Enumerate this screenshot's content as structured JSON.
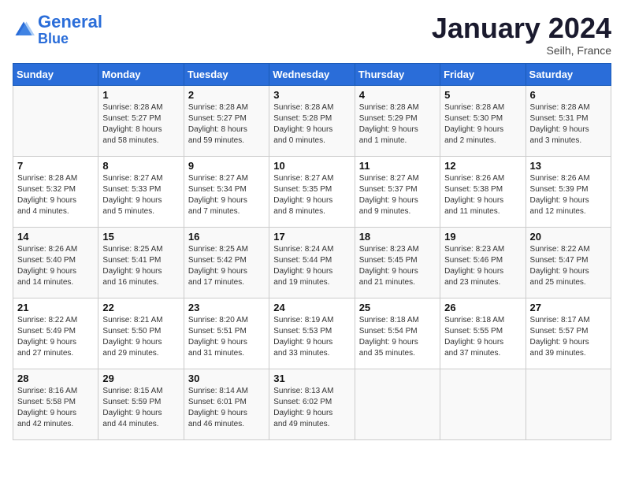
{
  "header": {
    "logo_line1": "General",
    "logo_line2": "Blue",
    "month_title": "January 2024",
    "location": "Seilh, France"
  },
  "days_of_week": [
    "Sunday",
    "Monday",
    "Tuesday",
    "Wednesday",
    "Thursday",
    "Friday",
    "Saturday"
  ],
  "weeks": [
    [
      {
        "day": "",
        "info": ""
      },
      {
        "day": "1",
        "info": "Sunrise: 8:28 AM\nSunset: 5:27 PM\nDaylight: 8 hours\nand 58 minutes."
      },
      {
        "day": "2",
        "info": "Sunrise: 8:28 AM\nSunset: 5:27 PM\nDaylight: 8 hours\nand 59 minutes."
      },
      {
        "day": "3",
        "info": "Sunrise: 8:28 AM\nSunset: 5:28 PM\nDaylight: 9 hours\nand 0 minutes."
      },
      {
        "day": "4",
        "info": "Sunrise: 8:28 AM\nSunset: 5:29 PM\nDaylight: 9 hours\nand 1 minute."
      },
      {
        "day": "5",
        "info": "Sunrise: 8:28 AM\nSunset: 5:30 PM\nDaylight: 9 hours\nand 2 minutes."
      },
      {
        "day": "6",
        "info": "Sunrise: 8:28 AM\nSunset: 5:31 PM\nDaylight: 9 hours\nand 3 minutes."
      }
    ],
    [
      {
        "day": "7",
        "info": "Sunrise: 8:28 AM\nSunset: 5:32 PM\nDaylight: 9 hours\nand 4 minutes."
      },
      {
        "day": "8",
        "info": "Sunrise: 8:27 AM\nSunset: 5:33 PM\nDaylight: 9 hours\nand 5 minutes."
      },
      {
        "day": "9",
        "info": "Sunrise: 8:27 AM\nSunset: 5:34 PM\nDaylight: 9 hours\nand 7 minutes."
      },
      {
        "day": "10",
        "info": "Sunrise: 8:27 AM\nSunset: 5:35 PM\nDaylight: 9 hours\nand 8 minutes."
      },
      {
        "day": "11",
        "info": "Sunrise: 8:27 AM\nSunset: 5:37 PM\nDaylight: 9 hours\nand 9 minutes."
      },
      {
        "day": "12",
        "info": "Sunrise: 8:26 AM\nSunset: 5:38 PM\nDaylight: 9 hours\nand 11 minutes."
      },
      {
        "day": "13",
        "info": "Sunrise: 8:26 AM\nSunset: 5:39 PM\nDaylight: 9 hours\nand 12 minutes."
      }
    ],
    [
      {
        "day": "14",
        "info": "Sunrise: 8:26 AM\nSunset: 5:40 PM\nDaylight: 9 hours\nand 14 minutes."
      },
      {
        "day": "15",
        "info": "Sunrise: 8:25 AM\nSunset: 5:41 PM\nDaylight: 9 hours\nand 16 minutes."
      },
      {
        "day": "16",
        "info": "Sunrise: 8:25 AM\nSunset: 5:42 PM\nDaylight: 9 hours\nand 17 minutes."
      },
      {
        "day": "17",
        "info": "Sunrise: 8:24 AM\nSunset: 5:44 PM\nDaylight: 9 hours\nand 19 minutes."
      },
      {
        "day": "18",
        "info": "Sunrise: 8:23 AM\nSunset: 5:45 PM\nDaylight: 9 hours\nand 21 minutes."
      },
      {
        "day": "19",
        "info": "Sunrise: 8:23 AM\nSunset: 5:46 PM\nDaylight: 9 hours\nand 23 minutes."
      },
      {
        "day": "20",
        "info": "Sunrise: 8:22 AM\nSunset: 5:47 PM\nDaylight: 9 hours\nand 25 minutes."
      }
    ],
    [
      {
        "day": "21",
        "info": "Sunrise: 8:22 AM\nSunset: 5:49 PM\nDaylight: 9 hours\nand 27 minutes."
      },
      {
        "day": "22",
        "info": "Sunrise: 8:21 AM\nSunset: 5:50 PM\nDaylight: 9 hours\nand 29 minutes."
      },
      {
        "day": "23",
        "info": "Sunrise: 8:20 AM\nSunset: 5:51 PM\nDaylight: 9 hours\nand 31 minutes."
      },
      {
        "day": "24",
        "info": "Sunrise: 8:19 AM\nSunset: 5:53 PM\nDaylight: 9 hours\nand 33 minutes."
      },
      {
        "day": "25",
        "info": "Sunrise: 8:18 AM\nSunset: 5:54 PM\nDaylight: 9 hours\nand 35 minutes."
      },
      {
        "day": "26",
        "info": "Sunrise: 8:18 AM\nSunset: 5:55 PM\nDaylight: 9 hours\nand 37 minutes."
      },
      {
        "day": "27",
        "info": "Sunrise: 8:17 AM\nSunset: 5:57 PM\nDaylight: 9 hours\nand 39 minutes."
      }
    ],
    [
      {
        "day": "28",
        "info": "Sunrise: 8:16 AM\nSunset: 5:58 PM\nDaylight: 9 hours\nand 42 minutes."
      },
      {
        "day": "29",
        "info": "Sunrise: 8:15 AM\nSunset: 5:59 PM\nDaylight: 9 hours\nand 44 minutes."
      },
      {
        "day": "30",
        "info": "Sunrise: 8:14 AM\nSunset: 6:01 PM\nDaylight: 9 hours\nand 46 minutes."
      },
      {
        "day": "31",
        "info": "Sunrise: 8:13 AM\nSunset: 6:02 PM\nDaylight: 9 hours\nand 49 minutes."
      },
      {
        "day": "",
        "info": ""
      },
      {
        "day": "",
        "info": ""
      },
      {
        "day": "",
        "info": ""
      }
    ]
  ]
}
